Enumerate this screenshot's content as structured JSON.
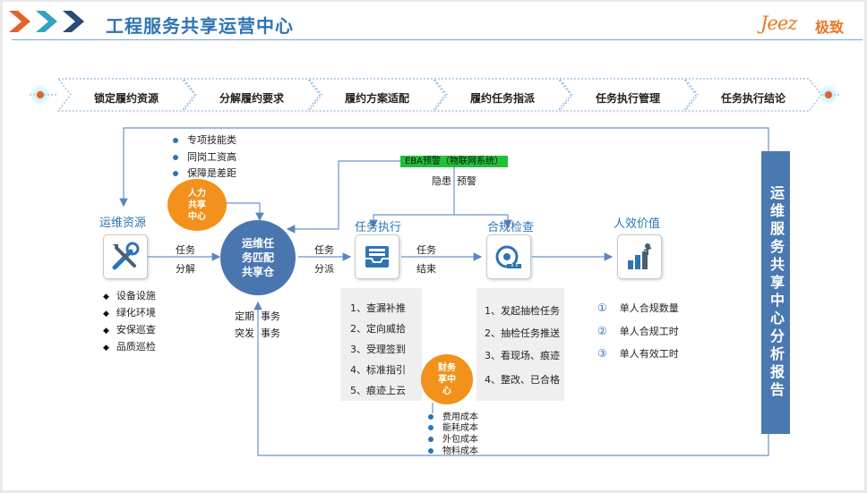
{
  "header": {
    "title": "工程服务共享运营中心",
    "logo_text": "Jeez",
    "logo_cn": "极致"
  },
  "process_steps": [
    "锁定履约资源",
    "分解履约要求",
    "履约方案适配",
    "履约任务指派",
    "任务执行管理",
    "任务执行结论"
  ],
  "hr_bullets": [
    "专项技能类",
    "同岗工资高",
    "保障是差距"
  ],
  "hr_center": "人力\n共享\n中心",
  "resources": {
    "title": "运维资源",
    "items": [
      "设备设施",
      "绿化环境",
      "安保巡查",
      "品质巡检"
    ]
  },
  "core": "运维任\n务匹配\n共享仓",
  "arrow_labels": {
    "task": "任务",
    "decompose": "分解",
    "task2": "任务",
    "dispatch": "分派",
    "task3": "任务",
    "finish": "结束"
  },
  "regular_event": {
    "line1_a": "定期",
    "line1_b": "事务",
    "line2_a": "突发",
    "line2_b": "事务"
  },
  "eba": {
    "label": "EBA预警（物联网系统）",
    "hazard": "隐患",
    "warning": "预警"
  },
  "task_exec": {
    "title": "任务执行",
    "items": [
      "1、查漏补推",
      "2、定向威拾",
      "3、受理签到",
      "4、标准指引",
      "5、痕迹上云"
    ]
  },
  "compliance": {
    "title": "合规检查",
    "items": [
      "1、发起抽检任务",
      "2、抽检任务推送",
      "3、看现场、痕迹",
      "4、整改、已合格"
    ]
  },
  "effectiveness": {
    "title": "人效价值",
    "markers": [
      "①",
      "②",
      "③"
    ],
    "items": [
      "单人合规数量",
      "单人合规工时",
      "单人有效工时"
    ]
  },
  "finance_center": "财务\n享中\n心",
  "finance_bullets": [
    "费用成本",
    "能耗成本",
    "外包成本",
    "物料成本"
  ],
  "report": "运维服务共享中心分析报告",
  "colors": {
    "primary": "#2e74b5",
    "orange": "#f2911b",
    "green": "#21c03a",
    "circle_blue": "#4a76b0"
  }
}
